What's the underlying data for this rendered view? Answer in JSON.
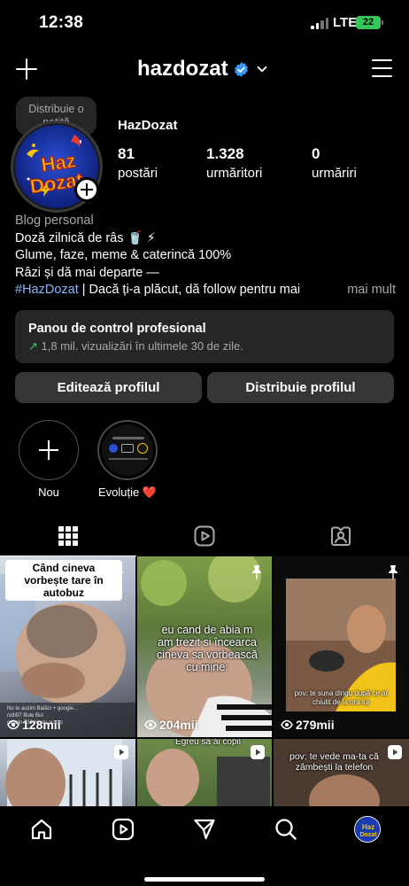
{
  "status_bar": {
    "time": "12:38",
    "network": "LTE",
    "battery": "22"
  },
  "header": {
    "username": "hazdozat"
  },
  "profile": {
    "note_bubble": "Distribuie o notiță",
    "display_name": "HazDozat",
    "avatar_logo_text": "Haz Dozat",
    "stats": [
      {
        "value": "81",
        "label": "postări"
      },
      {
        "value": "1.328",
        "label": "urmăritori"
      },
      {
        "value": "0",
        "label": "urmăriri"
      }
    ],
    "bio": {
      "category": "Blog personal",
      "line1": "Doză zilnică de râs 🥤 ⚡",
      "line2": "Glume, faze, meme & caterincă 100%",
      "line3": "Râzi și dă mai departe —",
      "hashtag": "#HazDozat",
      "line4_rest": " | Dacă ți-a plăcut, dă follow pentru mai",
      "more": "mai mult"
    }
  },
  "dashboard": {
    "title": "Panou de control profesional",
    "arrow": "↗",
    "subtitle": "1,8 mil. vizualizări în ultimele 30 de zile."
  },
  "buttons": {
    "edit": "Editează profilul",
    "share": "Distribuie profilul"
  },
  "highlights": [
    {
      "label": "Nou"
    },
    {
      "label": "Evoluție ❤️"
    }
  ],
  "grid": {
    "cells": [
      {
        "caption": "Când cineva vorbește tare în autobuz",
        "views": "128mii",
        "pinned": true
      },
      {
        "caption": "eu cand de abia m am trezit si încearca cineva sa vorbească cu mine:",
        "views": "204mii",
        "pinned": true
      },
      {
        "caption": "pov: te suna dirigu după ce ai chiulit de la ora lui",
        "views": "279mii",
        "pinned": true
      },
      {
        "caption": "",
        "views": ""
      },
      {
        "caption": "Egreu sa ai copil",
        "views": ""
      },
      {
        "caption": "pov: te vede ma-ta că zâmbești la telefon",
        "views": ""
      }
    ],
    "small_text": [
      "Nu te auzim Balăci + google...",
      "rotti97",
      "Bule Bul",
      "catalin.733",
      "Nu te auzim"
    ]
  },
  "colors": {
    "background": "#000000",
    "surface": "#262626",
    "button": "#363636",
    "link": "#8ab4f8",
    "verified": "#3897f0"
  }
}
